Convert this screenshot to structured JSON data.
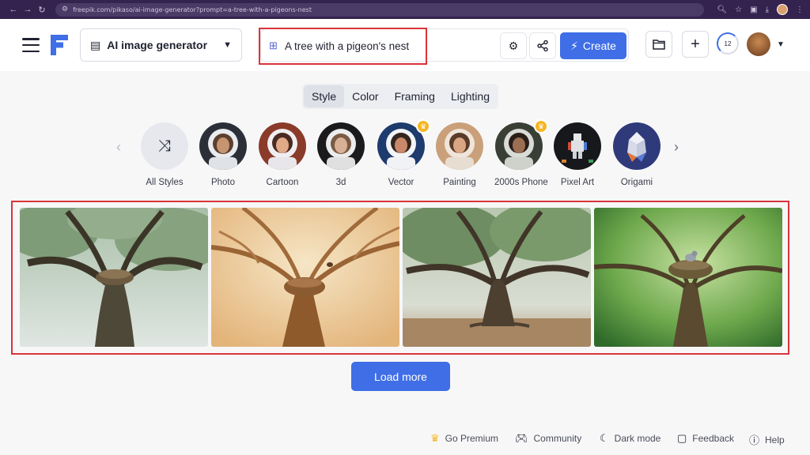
{
  "browser": {
    "url": "freepik.com/pikaso/ai-image-generator?prompt=a-tree-with-a-pigeons-nest"
  },
  "header": {
    "tool_select": "AI image generator",
    "prompt": "A tree with a pigeon's nest",
    "create_label": "Create",
    "credits": "12"
  },
  "tabs": [
    {
      "label": "Style",
      "active": true
    },
    {
      "label": "Color",
      "active": false
    },
    {
      "label": "Framing",
      "active": false
    },
    {
      "label": "Lighting",
      "active": false
    }
  ],
  "styles": [
    {
      "label": "All Styles"
    },
    {
      "label": "Photo"
    },
    {
      "label": "Cartoon"
    },
    {
      "label": "3d"
    },
    {
      "label": "Vector",
      "premium": true
    },
    {
      "label": "Painting"
    },
    {
      "label": "2000s Phone",
      "premium": true
    },
    {
      "label": "Pixel Art"
    },
    {
      "label": "Origami"
    }
  ],
  "load_more_label": "Load more",
  "footer": {
    "premium": "Go Premium",
    "community": "Community",
    "dark_mode": "Dark mode",
    "feedback": "Feedback",
    "help": "Help"
  },
  "colors": {
    "accent": "#3f6ee6",
    "highlight": "#d9343a",
    "browser_bar": "#35234f",
    "premium_crown": "#f5b623"
  }
}
